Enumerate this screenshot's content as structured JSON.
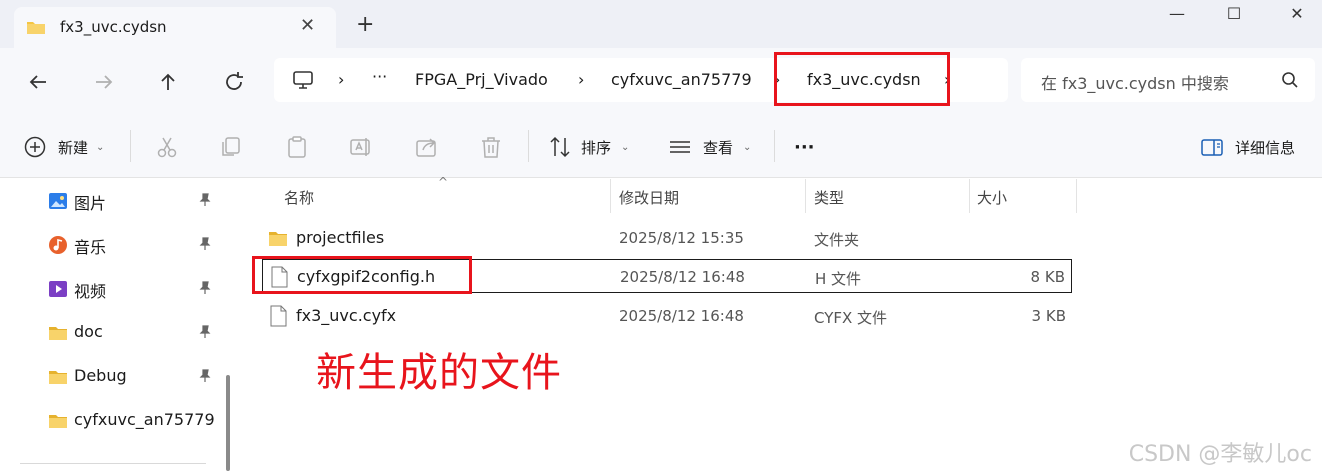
{
  "window": {
    "tab_title": "fx3_uvc.cydsn",
    "tab_close": "✕",
    "new_tab": "+",
    "minimize": "—",
    "maximize": "☐",
    "close": "✕"
  },
  "address_bar": {
    "crumbs": [
      "FPGA_Prj_Vivado",
      "cyfxuvc_an75779",
      "fx3_uvc.cydsn"
    ],
    "ellipsis": "···",
    "separator": "›"
  },
  "search": {
    "placeholder": "在 fx3_uvc.cydsn 中搜索"
  },
  "command_bar": {
    "new_label": "新建",
    "sort_label": "排序",
    "view_label": "查看",
    "more_label": "···",
    "details_label": "详细信息"
  },
  "nav_pane": {
    "items": [
      {
        "label": "图片",
        "icon": "pictures-icon",
        "pinned": true
      },
      {
        "label": "音乐",
        "icon": "music-icon",
        "pinned": true
      },
      {
        "label": "视频",
        "icon": "videos-icon",
        "pinned": true
      },
      {
        "label": "doc",
        "icon": "folder-icon",
        "pinned": true
      },
      {
        "label": "Debug",
        "icon": "folder-icon",
        "pinned": true
      },
      {
        "label": "cyfxuvc_an75779",
        "icon": "folder-icon",
        "pinned": false
      }
    ]
  },
  "file_list": {
    "columns": {
      "name": "名称",
      "modified": "修改日期",
      "type": "类型",
      "size": "大小"
    },
    "rows": [
      {
        "name": "projectfiles",
        "modified": "2025/8/12 15:35",
        "type": "文件夹",
        "size": "",
        "kind": "folder"
      },
      {
        "name": "cyfxgpif2config.h",
        "modified": "2025/8/12 16:48",
        "type": "H 文件",
        "size": "8 KB",
        "kind": "file",
        "selected": true
      },
      {
        "name": "fx3_uvc.cyfx",
        "modified": "2025/8/12 16:48",
        "type": "CYFX 文件",
        "size": "3 KB",
        "kind": "file"
      }
    ]
  },
  "annotation": {
    "text": "新生成的文件",
    "color": "#e8141c"
  },
  "watermark": "CSDN @李敏儿oc",
  "colors": {
    "folder_yellow": "#f4c542",
    "accent_blue": "#1a5fb4"
  }
}
